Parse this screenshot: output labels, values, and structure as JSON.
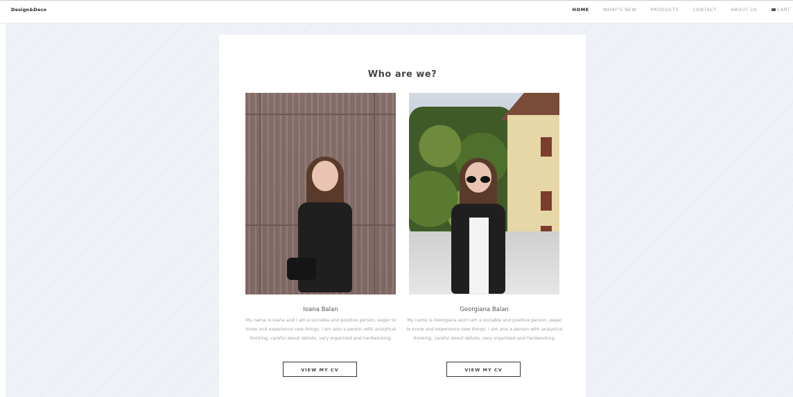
{
  "header": {
    "brand": "Design&Deco",
    "nav": [
      "HOME",
      "WHAT'S NEW",
      "PRODUCTS",
      "CONTACT",
      "ABOUT US"
    ],
    "active_item": "HOME",
    "cart_label": "CART"
  },
  "section": {
    "title": "Who are we?"
  },
  "people": [
    {
      "name": "Ioana Balan",
      "bio": "My name is Ioana and I am a sociable and positive person, eager to know and experience new things. I am also a person with analytical thinking, careful about details, very organized and hardworking.",
      "button_label": "VIEW MY CV"
    },
    {
      "name": "Georgiana Balan",
      "bio": "My name is Georgiana and I am a sociable and positive person, eager to know and experience new things. I am also a person with analytical thinking, careful about details, very organized and hardworking.",
      "button_label": "VIEW MY CV"
    }
  ],
  "colors": {
    "page_bg": "#eef2f7",
    "card_bg": "#ffffff",
    "text_dark": "#444444",
    "text_muted": "#9aa0a8"
  },
  "icons": {
    "cart": "cart-icon"
  }
}
